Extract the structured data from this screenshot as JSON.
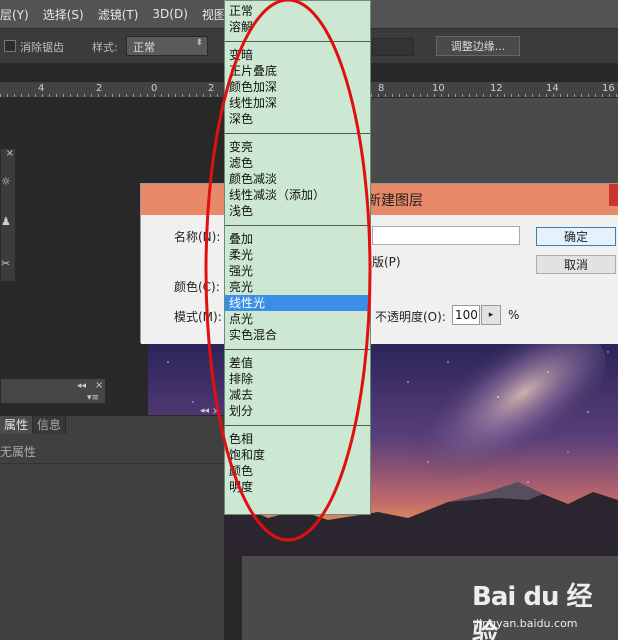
{
  "menubar": {
    "items": [
      "层(Y)",
      "选择(S)",
      "滤镜(T)",
      "3D(D)",
      "视图(V)"
    ]
  },
  "options": {
    "antialias_label": "消除锯齿",
    "style_label": "样式:",
    "style_value": "正常",
    "refine_label": "调整边缘..."
  },
  "ruler": {
    "labels": [
      "4",
      "2",
      "0",
      "2",
      "8",
      "10",
      "12",
      "14",
      "16"
    ]
  },
  "tool_panel": {
    "close_symbol": "×",
    "icons": [
      "☼",
      "♟",
      "✂"
    ]
  },
  "small_panel": {
    "collapse_symbol": "◂◂",
    "close_symbol": "×",
    "menu_symbol": "▾≡"
  },
  "properties_panel": {
    "tabs": [
      "属性",
      "信息"
    ],
    "content": "无属性",
    "collapse_symbol": "◂◂",
    "close_symbol": "×"
  },
  "dialog": {
    "title": "新建图层",
    "name_label": "名称(N):",
    "color_label": "颜色(C):",
    "mode_label": "模式(M):",
    "clip_label": "版(P)",
    "opacity_label": "不透明度(O):",
    "opacity_value": "100",
    "opacity_unit": "%",
    "ok_label": "确定",
    "cancel_label": "取消",
    "arrow_symbol": "▸"
  },
  "blend_mode_menu": {
    "selected": "线性光",
    "groups": [
      [
        "正常",
        "溶解"
      ],
      [
        "变暗",
        "正片叠底",
        "颜色加深",
        "线性加深",
        "深色"
      ],
      [
        "变亮",
        "滤色",
        "颜色减淡",
        "线性减淡（添加）",
        "浅色"
      ],
      [
        "叠加",
        "柔光",
        "强光",
        "亮光",
        "线性光",
        "点光",
        "实色混合"
      ],
      [
        "差值",
        "排除",
        "减去",
        "划分"
      ],
      [
        "色相",
        "饱和度",
        "颜色",
        "明度"
      ]
    ]
  },
  "annotation": {
    "color": "#e01010"
  },
  "watermark": {
    "brand": "Bai du 经验",
    "url": "jingyan.baidu.com"
  },
  "colors": {
    "menu_bg": "#cde8d2",
    "menu_selected": "#3a8ee6",
    "dialog_title": "#e8896a"
  }
}
